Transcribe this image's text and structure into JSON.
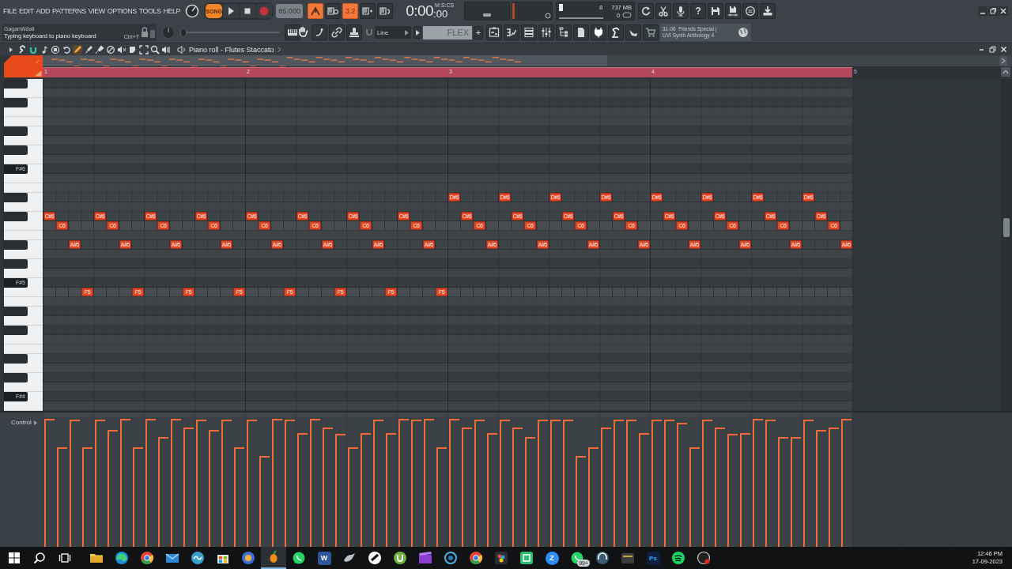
{
  "menu": [
    "FILE",
    "EDIT",
    "ADD",
    "PATTERNS",
    "VIEW",
    "OPTIONS",
    "TOOLS",
    "HELP"
  ],
  "transport": {
    "mode": "SONG",
    "tempo": "85.000"
  },
  "mode_buttons": [
    {
      "on": true
    },
    {
      "on": false
    },
    {
      "label": "3.2",
      "on": true
    },
    {
      "on": false
    },
    {
      "on": false
    }
  ],
  "time": {
    "main": "0:00",
    "sub": ":00",
    "format": "M:S:CS"
  },
  "monitor": {
    "cpu": "8",
    "memory": "737 MB",
    "polyphony": "0"
  },
  "help_button": "?",
  "hint": {
    "user": "GaganWdali",
    "message": "Typing keyboard to piano keyboard",
    "shortcut": "Ctrl+T"
  },
  "pitch_slider": {
    "level": 0
  },
  "snap": "Line",
  "preset": {
    "name": "FLEX",
    "add": "+"
  },
  "project": {
    "line1": "31-06  Friends Special |",
    "line2": "UVI Synth Anthology 4"
  },
  "piano_roll": {
    "title": "Piano roll - Flutes Staccato",
    "tools": [
      {
        "selected": true
      },
      {
        "selected": false
      },
      {
        "selected": false
      },
      {
        "selected": false
      },
      {
        "selected": false
      },
      {
        "selected": false
      },
      {
        "selected": false
      },
      {
        "selected": false
      },
      {
        "selected": false
      }
    ],
    "ruler": [
      "1",
      "2",
      "3",
      "4",
      "5"
    ],
    "rows": [
      {
        "kind": "black"
      },
      {
        "kind": "white"
      },
      {
        "kind": "black"
      },
      {
        "kind": "white"
      },
      {
        "kind": "white"
      },
      {
        "kind": "black"
      },
      {
        "kind": "white"
      },
      {
        "kind": "black"
      },
      {
        "kind": "white"
      },
      {
        "kind": "black",
        "label": "F#6"
      },
      {
        "kind": "white"
      },
      {
        "kind": "white"
      },
      {
        "kind": "black",
        "steps": [
          {
            "on": false
          },
          {
            "on": false
          },
          {
            "on": false
          },
          {
            "on": false
          },
          {
            "on": false
          },
          {
            "on": false
          },
          {
            "on": false
          },
          {
            "on": false
          },
          {
            "on": false
          },
          {
            "on": false
          },
          {
            "on": false
          },
          {
            "on": false
          },
          {
            "on": false
          },
          {
            "on": false
          },
          {
            "on": false
          },
          {
            "on": false
          },
          {
            "on": false
          },
          {
            "on": false
          },
          {
            "on": false
          },
          {
            "on": false
          },
          {
            "on": false
          },
          {
            "on": false
          },
          {
            "on": false
          },
          {
            "on": false
          },
          {
            "on": false
          },
          {
            "on": false
          },
          {
            "on": false
          },
          {
            "on": false
          },
          {
            "on": false
          },
          {
            "on": false
          },
          {
            "on": false
          },
          {
            "on": false
          },
          {
            "on": true,
            "label": "D#6",
            "level": 0.99
          },
          {
            "on": false
          },
          {
            "on": false
          },
          {
            "on": false
          },
          {
            "on": true,
            "label": "D#6",
            "level": 0.98
          },
          {
            "on": false
          },
          {
            "on": false
          },
          {
            "on": false
          },
          {
            "on": true,
            "label": "D#6",
            "level": 0.98
          },
          {
            "on": false
          },
          {
            "on": false
          },
          {
            "on": false
          },
          {
            "on": true,
            "label": "D#6",
            "level": 0.92
          },
          {
            "on": false
          },
          {
            "on": false
          },
          {
            "on": false
          },
          {
            "on": true,
            "label": "D#6",
            "level": 0.98
          },
          {
            "on": false
          },
          {
            "on": false
          },
          {
            "on": false
          },
          {
            "on": true,
            "label": "D#6",
            "level": 0.98
          },
          {
            "on": false
          },
          {
            "on": false
          },
          {
            "on": false
          },
          {
            "on": true,
            "label": "D#6",
            "level": 0.99
          },
          {
            "on": false
          },
          {
            "on": false
          },
          {
            "on": false
          },
          {
            "on": true,
            "label": "D#6",
            "level": 0.98
          },
          {
            "on": false
          },
          {
            "on": false
          },
          {
            "on": false
          }
        ]
      },
      {
        "kind": "white"
      },
      {
        "kind": "black",
        "steps": [
          {
            "on": true,
            "label": "C#6",
            "level": 0.99
          },
          {
            "on": false
          },
          {
            "on": false
          },
          {
            "on": false
          },
          {
            "on": true,
            "label": "C#6",
            "level": 0.98
          },
          {
            "on": false
          },
          {
            "on": false
          },
          {
            "on": false
          },
          {
            "on": true,
            "label": "C#6",
            "level": 0.99
          },
          {
            "on": false
          },
          {
            "on": false
          },
          {
            "on": false
          },
          {
            "on": true,
            "label": "C#6",
            "level": 0.98
          },
          {
            "on": false
          },
          {
            "on": false
          },
          {
            "on": false
          },
          {
            "on": true,
            "label": "C#6",
            "level": 0.98
          },
          {
            "on": false
          },
          {
            "on": false
          },
          {
            "on": false
          },
          {
            "on": true,
            "label": "C#6",
            "level": 0.88
          },
          {
            "on": false
          },
          {
            "on": false
          },
          {
            "on": false
          },
          {
            "on": true,
            "label": "C#6",
            "level": 0.77
          },
          {
            "on": false
          },
          {
            "on": false
          },
          {
            "on": false
          },
          {
            "on": true,
            "label": "C#6",
            "level": 0.99
          },
          {
            "on": false
          },
          {
            "on": false
          },
          {
            "on": false
          },
          {
            "on": false
          },
          {
            "on": true,
            "label": "C#6",
            "level": 0.92
          },
          {
            "on": false
          },
          {
            "on": false
          },
          {
            "on": false
          },
          {
            "on": true,
            "label": "C#6",
            "level": 0.92
          },
          {
            "on": false
          },
          {
            "on": false
          },
          {
            "on": false
          },
          {
            "on": true,
            "label": "C#6",
            "level": 0.98
          },
          {
            "on": false
          },
          {
            "on": false
          },
          {
            "on": false
          },
          {
            "on": true,
            "label": "C#6",
            "level": 0.98
          },
          {
            "on": false
          },
          {
            "on": false
          },
          {
            "on": false
          },
          {
            "on": true,
            "label": "C#6",
            "level": 0.98
          },
          {
            "on": false
          },
          {
            "on": false
          },
          {
            "on": false
          },
          {
            "on": true,
            "label": "C#6",
            "level": 0.92
          },
          {
            "on": false
          },
          {
            "on": false
          },
          {
            "on": false
          },
          {
            "on": true,
            "label": "C#6",
            "level": 0.98
          },
          {
            "on": false
          },
          {
            "on": false
          },
          {
            "on": false
          },
          {
            "on": true,
            "label": "C#6",
            "level": 0.9
          },
          {
            "on": false
          },
          {
            "on": false
          }
        ]
      },
      {
        "kind": "white",
        "steps": [
          {
            "on": false
          },
          {
            "on": true,
            "label": "C6",
            "level": 0.77
          },
          {
            "on": false
          },
          {
            "on": false
          },
          {
            "on": false
          },
          {
            "on": true,
            "label": "C6",
            "level": 0.9
          },
          {
            "on": false
          },
          {
            "on": false
          },
          {
            "on": false
          },
          {
            "on": true,
            "label": "C6",
            "level": 0.85
          },
          {
            "on": false
          },
          {
            "on": false
          },
          {
            "on": false
          },
          {
            "on": true,
            "label": "C6",
            "level": 0.9
          },
          {
            "on": false
          },
          {
            "on": false
          },
          {
            "on": false
          },
          {
            "on": true,
            "label": "C6",
            "level": 0.7
          },
          {
            "on": false
          },
          {
            "on": false
          },
          {
            "on": false
          },
          {
            "on": true,
            "label": "C6",
            "level": 0.99
          },
          {
            "on": false
          },
          {
            "on": false
          },
          {
            "on": false
          },
          {
            "on": true,
            "label": "C6",
            "level": 0.88
          },
          {
            "on": false
          },
          {
            "on": false
          },
          {
            "on": false
          },
          {
            "on": true,
            "label": "C6",
            "level": 0.98
          },
          {
            "on": false
          },
          {
            "on": false
          },
          {
            "on": false
          },
          {
            "on": false
          },
          {
            "on": true,
            "label": "C6",
            "level": 0.98
          },
          {
            "on": false
          },
          {
            "on": false
          },
          {
            "on": false
          },
          {
            "on": true,
            "label": "C6",
            "level": 0.85
          },
          {
            "on": false
          },
          {
            "on": false
          },
          {
            "on": false
          },
          {
            "on": true,
            "label": "C6",
            "level": 0.7
          },
          {
            "on": false
          },
          {
            "on": false
          },
          {
            "on": false
          },
          {
            "on": true,
            "label": "C6",
            "level": 0.98
          },
          {
            "on": false
          },
          {
            "on": false
          },
          {
            "on": false
          },
          {
            "on": true,
            "label": "C6",
            "level": 0.96
          },
          {
            "on": false
          },
          {
            "on": false
          },
          {
            "on": false
          },
          {
            "on": true,
            "label": "C6",
            "level": 0.87
          },
          {
            "on": false
          },
          {
            "on": false
          },
          {
            "on": false
          },
          {
            "on": true,
            "label": "C6",
            "level": 0.85
          },
          {
            "on": false
          },
          {
            "on": false
          },
          {
            "on": false
          },
          {
            "on": true,
            "label": "C6",
            "level": 0.92
          },
          {
            "on": false
          }
        ]
      },
      {
        "kind": "white"
      },
      {
        "kind": "black",
        "steps": [
          {
            "on": false
          },
          {
            "on": false
          },
          {
            "on": true,
            "label": "A#5",
            "level": 0.98
          },
          {
            "on": false
          },
          {
            "on": false
          },
          {
            "on": false
          },
          {
            "on": true,
            "label": "A#5",
            "level": 0.99
          },
          {
            "on": false
          },
          {
            "on": false
          },
          {
            "on": false
          },
          {
            "on": true,
            "label": "A#5",
            "level": 0.99
          },
          {
            "on": false
          },
          {
            "on": false
          },
          {
            "on": false
          },
          {
            "on": true,
            "label": "A#5",
            "level": 0.98
          },
          {
            "on": false
          },
          {
            "on": false
          },
          {
            "on": false
          },
          {
            "on": true,
            "label": "A#5",
            "level": 0.99
          },
          {
            "on": false
          },
          {
            "on": false
          },
          {
            "on": false
          },
          {
            "on": true,
            "label": "A#5",
            "level": 0.92
          },
          {
            "on": false
          },
          {
            "on": false
          },
          {
            "on": false
          },
          {
            "on": true,
            "label": "A#5",
            "level": 0.98
          },
          {
            "on": false
          },
          {
            "on": false
          },
          {
            "on": false
          },
          {
            "on": true,
            "label": "A#5",
            "level": 0.99
          },
          {
            "on": false
          },
          {
            "on": false
          },
          {
            "on": false
          },
          {
            "on": false
          },
          {
            "on": true,
            "label": "A#5",
            "level": 0.88
          },
          {
            "on": false
          },
          {
            "on": false
          },
          {
            "on": false
          },
          {
            "on": true,
            "label": "A#5",
            "level": 0.98
          },
          {
            "on": false
          },
          {
            "on": false
          },
          {
            "on": false
          },
          {
            "on": true,
            "label": "A#5",
            "level": 0.77
          },
          {
            "on": false
          },
          {
            "on": false
          },
          {
            "on": false
          },
          {
            "on": true,
            "label": "A#5",
            "level": 0.88
          },
          {
            "on": false
          },
          {
            "on": false
          },
          {
            "on": false
          },
          {
            "on": true,
            "label": "A#5",
            "level": 0.77
          },
          {
            "on": false
          },
          {
            "on": false
          },
          {
            "on": false
          },
          {
            "on": true,
            "label": "A#5",
            "level": 0.88
          },
          {
            "on": false
          },
          {
            "on": false
          },
          {
            "on": false
          },
          {
            "on": true,
            "label": "A#5",
            "level": 0.85
          },
          {
            "on": false
          },
          {
            "on": false
          },
          {
            "on": false
          },
          {
            "on": true,
            "label": "A#5",
            "level": 0.99
          }
        ]
      },
      {
        "kind": "white"
      },
      {
        "kind": "black"
      },
      {
        "kind": "white"
      },
      {
        "kind": "black",
        "label": "F#5"
      },
      {
        "kind": "white",
        "steps": [
          {
            "on": false
          },
          {
            "on": false
          },
          {
            "on": false
          },
          {
            "on": true,
            "label": "F5",
            "level": 0.77
          },
          {
            "on": false
          },
          {
            "on": false
          },
          {
            "on": false
          },
          {
            "on": true,
            "label": "F5",
            "level": 0.77
          },
          {
            "on": false
          },
          {
            "on": false
          },
          {
            "on": false
          },
          {
            "on": true,
            "label": "F5",
            "level": 0.92
          },
          {
            "on": false
          },
          {
            "on": false
          },
          {
            "on": false
          },
          {
            "on": true,
            "label": "F5",
            "level": 0.77
          },
          {
            "on": false
          },
          {
            "on": false
          },
          {
            "on": false
          },
          {
            "on": true,
            "label": "F5",
            "level": 0.98
          },
          {
            "on": false
          },
          {
            "on": false
          },
          {
            "on": false
          },
          {
            "on": true,
            "label": "F5",
            "level": 0.87
          },
          {
            "on": false
          },
          {
            "on": false
          },
          {
            "on": false
          },
          {
            "on": true,
            "label": "F5",
            "level": 0.88
          },
          {
            "on": false
          },
          {
            "on": false
          },
          {
            "on": false
          },
          {
            "on": true,
            "label": "F5",
            "level": 0.77
          },
          {
            "on": false
          },
          {
            "on": false
          },
          {
            "on": false
          },
          {
            "on": false
          },
          {
            "on": false
          },
          {
            "on": false
          },
          {
            "on": false
          },
          {
            "on": false
          },
          {
            "on": false
          },
          {
            "on": false
          },
          {
            "on": false
          },
          {
            "on": false
          },
          {
            "on": false
          },
          {
            "on": false
          },
          {
            "on": false
          },
          {
            "on": false
          },
          {
            "on": false
          },
          {
            "on": false
          },
          {
            "on": false
          },
          {
            "on": false
          },
          {
            "on": false
          },
          {
            "on": false
          },
          {
            "on": false
          },
          {
            "on": false
          },
          {
            "on": false
          },
          {
            "on": false
          },
          {
            "on": false
          },
          {
            "on": false
          },
          {
            "on": false
          },
          {
            "on": false
          },
          {
            "on": false
          },
          {
            "on": false
          }
        ]
      },
      {
        "kind": "white"
      },
      {
        "kind": "black"
      },
      {
        "kind": "white"
      },
      {
        "kind": "black"
      },
      {
        "kind": "white"
      },
      {
        "kind": "white"
      },
      {
        "kind": "black"
      },
      {
        "kind": "white"
      },
      {
        "kind": "black"
      },
      {
        "kind": "white"
      },
      {
        "kind": "black",
        "label": "F#4"
      },
      {
        "kind": "white"
      }
    ],
    "control_label": "Control"
  },
  "taskbar": {
    "apps": [
      {
        "active": false
      },
      {
        "active": false
      },
      {
        "active": false
      },
      {
        "active": false
      },
      {
        "active": false
      },
      {
        "active": false
      },
      {
        "active": false
      },
      {
        "active": true
      },
      {
        "active": false
      },
      {
        "active": false,
        "label": "W"
      },
      {
        "active": false
      },
      {
        "active": false
      },
      {
        "active": false
      },
      {
        "active": false
      },
      {
        "active": false
      },
      {
        "active": false
      },
      {
        "active": false
      },
      {
        "active": false
      },
      {
        "active": false,
        "label": "Z"
      },
      {
        "active": false,
        "badge": "99+"
      },
      {
        "active": false
      },
      {
        "active": false
      },
      {
        "active": false,
        "label": "Ps"
      },
      {
        "active": false
      },
      {
        "active": false
      }
    ],
    "time": "12:46 PM",
    "date": "17-09-2023"
  }
}
